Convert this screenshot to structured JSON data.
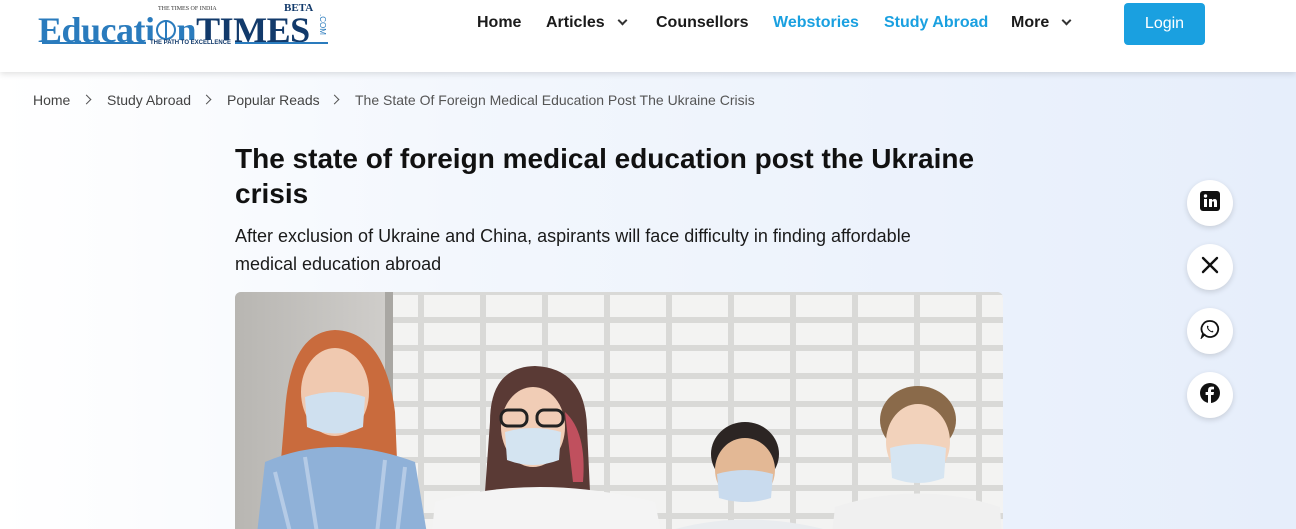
{
  "header": {
    "logo": {
      "main_left": "Educati",
      "main_right": "n",
      "times": "TIMES",
      "beta": "BETA",
      "publisher": "THE TIMES OF INDIA",
      "tagline": "THE PATH TO EXCELLENCE",
      "suffix": ".COM"
    },
    "nav": [
      {
        "label": "Home",
        "has_dropdown": false,
        "color": "#1a1a1a"
      },
      {
        "label": "Articles",
        "has_dropdown": true,
        "color": "#1a1a1a"
      },
      {
        "label": "Counsellors",
        "has_dropdown": false,
        "color": "#1a1a1a"
      },
      {
        "label": "Webstories",
        "has_dropdown": false,
        "color": "#1aa0e0"
      },
      {
        "label": "Study Abroad",
        "has_dropdown": false,
        "color": "#1aa0e0"
      },
      {
        "label": "More",
        "has_dropdown": true,
        "color": "#1a1a1a"
      }
    ],
    "login_label": "Login"
  },
  "breadcrumb": [
    "Home",
    "Study Abroad",
    "Popular Reads",
    "The State Of Foreign Medical Education Post The Ukraine Crisis"
  ],
  "article": {
    "title": "The state of foreign medical education post the Ukraine crisis",
    "subtitle": "After exclusion of Ukraine and China, aspirants will face difficulty in finding affordable medical education abroad",
    "image_description_icon": "students-wearing-masks-photo"
  },
  "share": [
    {
      "icon": "linkedin-icon"
    },
    {
      "icon": "x-twitter-icon"
    },
    {
      "icon": "whatsapp-icon"
    },
    {
      "icon": "facebook-icon"
    }
  ],
  "colors": {
    "accent": "#1aa0e0",
    "brand_dark": "#123a6b",
    "brand_light": "#2a7bbd"
  }
}
